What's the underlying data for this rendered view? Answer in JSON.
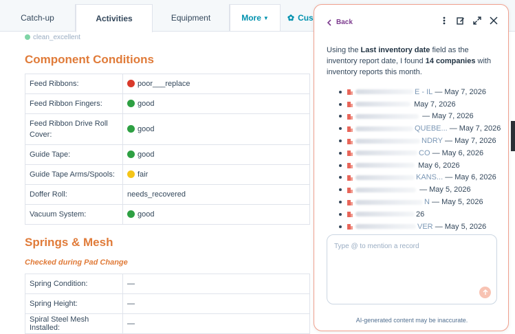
{
  "tabs": [
    {
      "label": "Catch-up"
    },
    {
      "label": "Activities"
    },
    {
      "label": "Equipment"
    },
    {
      "label": "More"
    },
    {
      "label": "Cus"
    }
  ],
  "cut_top_text": "clean_excellent",
  "component_conditions": {
    "title": "Component Conditions",
    "rows": [
      {
        "label": "Feed Ribbons:",
        "value": "poor___replace",
        "status": "red"
      },
      {
        "label": "Feed Ribbon Fingers:",
        "value": "good",
        "status": "green"
      },
      {
        "label": "Feed Ribbon Drive Roll Cover:",
        "value": "good",
        "status": "green"
      },
      {
        "label": "Guide Tape:",
        "value": "good",
        "status": "green"
      },
      {
        "label": "Guide Tape Arms/Spools:",
        "value": "fair",
        "status": "yellow"
      },
      {
        "label": "Doffer Roll:",
        "value": "needs_recovered",
        "status": ""
      },
      {
        "label": "Vacuum System:",
        "value": "good",
        "status": "green"
      }
    ]
  },
  "springs_mesh": {
    "title": "Springs & Mesh",
    "subtitle": "Checked during Pad Change",
    "rows": [
      {
        "label": "Spring Condition:",
        "value": "—"
      },
      {
        "label": "Spring Height:",
        "value": "—"
      },
      {
        "label": "Spiral Steel Mesh Installed:",
        "value": "—"
      }
    ]
  },
  "status_colors": {
    "red": "#d93a2b",
    "green": "#2ea043",
    "yellow": "#f5c518"
  },
  "panel": {
    "back_label": "Back",
    "intro": {
      "pre": "Using the ",
      "field": "Last inventory date",
      "mid": " field as the inventory report date, I found ",
      "count": "14 companies",
      "post": " with inventory reports this month."
    },
    "results": [
      {
        "visible_name": "E - IL",
        "date": "— May 7, 2026"
      },
      {
        "visible_name": "",
        "date": "May 7, 2026"
      },
      {
        "visible_name": "",
        "date": "— May 7, 2026"
      },
      {
        "visible_name": "QUEBE...",
        "date": "— May 7, 2026"
      },
      {
        "visible_name": "NDRY",
        "date": "— May 7, 2026"
      },
      {
        "visible_name": "CO",
        "date": "— May 6, 2026"
      },
      {
        "visible_name": "",
        "date": "May 6, 2026"
      },
      {
        "visible_name": "KANS...",
        "date": "— May 6, 2026"
      },
      {
        "visible_name": "",
        "date": "— May 5, 2026"
      },
      {
        "visible_name": "N",
        "date": "— May 5, 2026"
      },
      {
        "visible_name": "",
        "date": "26"
      },
      {
        "visible_name": "VER",
        "date": "— May 5, 2026"
      }
    ],
    "composer_placeholder": "Type @ to mention a record",
    "disclaimer": "AI-generated content may be inaccurate."
  },
  "icons": {
    "back": "chevron-left-icon",
    "more": "vertical-ellipsis-icon",
    "edit": "edit-icon",
    "expand": "expand-icon",
    "close": "close-icon",
    "company": "building-icon",
    "send": "send-icon",
    "settings": "gear-icon"
  }
}
